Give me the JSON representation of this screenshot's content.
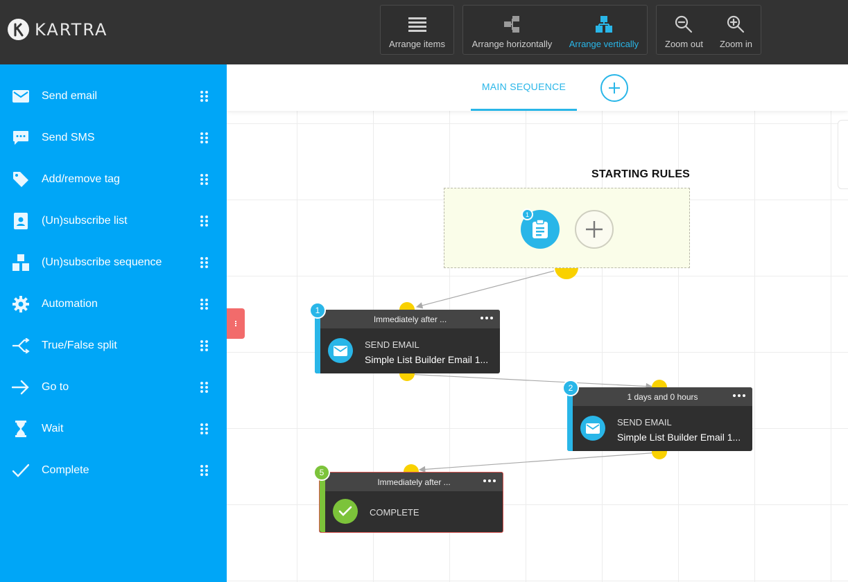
{
  "app": {
    "logo_text": "KARTRA"
  },
  "toolbar": {
    "arrange_items": "Arrange items",
    "arrange_horizontally": "Arrange horizontally",
    "arrange_vertically": "Arrange vertically",
    "zoom_out": "Zoom out",
    "zoom_in": "Zoom in",
    "active_color": "#29b6e8"
  },
  "sidebar": {
    "items": [
      {
        "label": "Send email",
        "icon": "envelope-icon"
      },
      {
        "label": "Send SMS",
        "icon": "chat-bubble-icon"
      },
      {
        "label": "Add/remove tag",
        "icon": "tag-icon"
      },
      {
        "label": "(Un)subscribe list",
        "icon": "contact-card-icon"
      },
      {
        "label": "(Un)subscribe sequence",
        "icon": "blocks-icon"
      },
      {
        "label": "Automation",
        "icon": "gear-icon"
      },
      {
        "label": "True/False split",
        "icon": "split-arrows-icon"
      },
      {
        "label": "Go to",
        "icon": "arrow-right-icon"
      },
      {
        "label": "Wait",
        "icon": "hourglass-icon"
      },
      {
        "label": "Complete",
        "icon": "checkmark-icon"
      }
    ],
    "color": "#00a6f7"
  },
  "canvas": {
    "tab_label": "MAIN SEQUENCE",
    "starting_rules": {
      "title": "STARTING RULES",
      "trigger_badge": "1"
    },
    "nodes": [
      {
        "badge": "1",
        "timing": "Immediately after ...",
        "type": "SEND EMAIL",
        "name": "Simple List Builder Email 1...",
        "accent": "#29b6e8"
      },
      {
        "badge": "2",
        "timing": "1 days and 0 hours",
        "type": "SEND EMAIL",
        "name": "Simple List Builder Email 1...",
        "accent": "#29b6e8"
      },
      {
        "badge": "5",
        "timing": "Immediately after ...",
        "type": "COMPLETE",
        "name": "",
        "accent": "#7cc33a"
      }
    ]
  }
}
